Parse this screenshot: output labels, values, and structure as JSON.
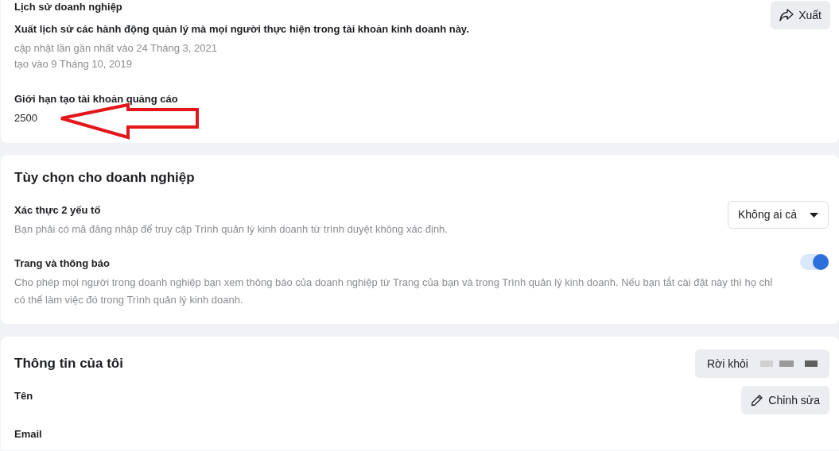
{
  "business_history": {
    "title": "Lịch sử doanh nghiệp",
    "export_button": "Xuất",
    "description": "Xuất lịch sử các hành động quản lý mà mọi người thực hiện trong tài khoản kinh doanh này.",
    "updated": "cập nhật lần gần nhất vào 24 Tháng 3, 2021",
    "created": "tạo vào 9 Tháng 10, 2019",
    "ad_limit_label": "Giới hạn tạo tài khoản quảng cáo",
    "ad_limit_value": "2500"
  },
  "business_options": {
    "title": "Tùy chọn cho doanh nghiệp",
    "settings": [
      {
        "kind": "dropdown",
        "title": "Xác thực 2 yếu tố",
        "description": "Bạn phải có mã đăng nhập để truy cập Trình quản lý kinh doanh từ trình duyệt không xác định.",
        "value": "Không ai cả"
      },
      {
        "kind": "toggle",
        "title": "Trang và thông báo",
        "description": "Cho phép mọi người trong doanh nghiệp bạn xem thông báo của doanh nghiệp từ Trang của bạn và trong Trình quản lý kinh doanh. Nếu bạn tắt cài đặt này thì họ chỉ có thể làm việc đó trong Trình quản lý kinh doanh.",
        "on": true
      }
    ]
  },
  "my_info": {
    "title": "Thông tin của tôi",
    "leave_button": "Rời khỏi",
    "edit_button": "Chỉnh sửa",
    "fields": [
      {
        "label": "Tên"
      },
      {
        "label": "Email"
      }
    ]
  }
}
